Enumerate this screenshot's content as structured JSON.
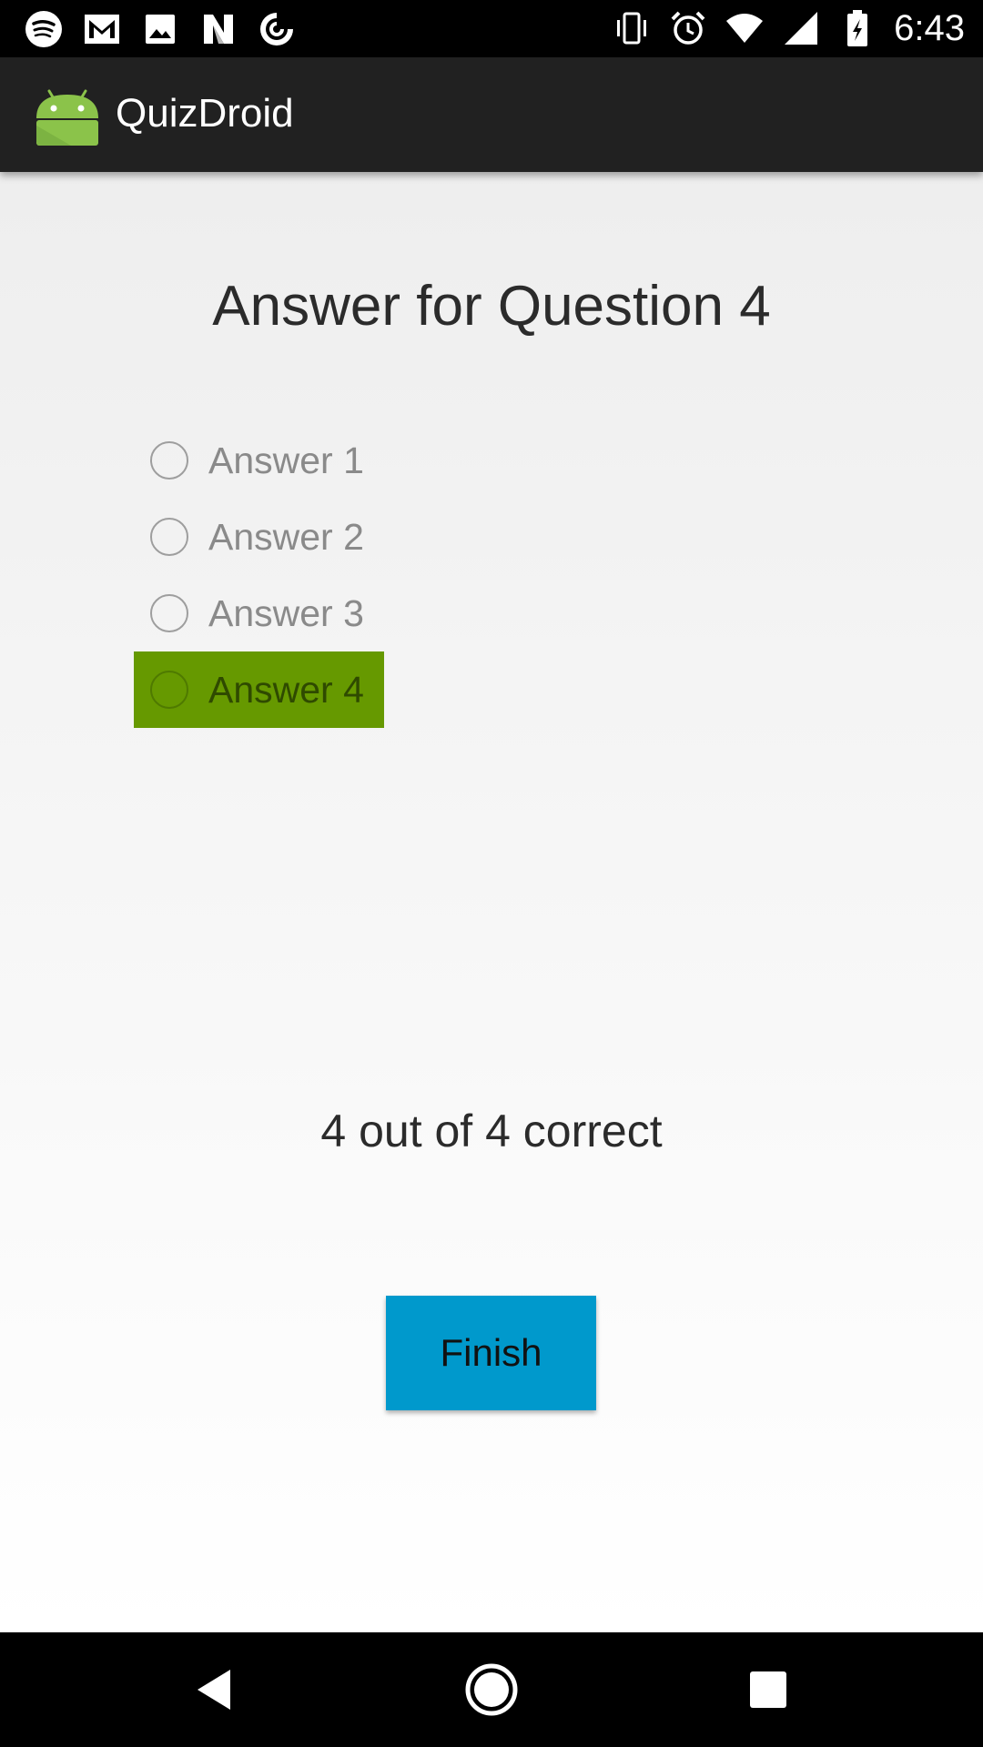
{
  "status_bar": {
    "time": "6:43",
    "left_icons": [
      "spotify-icon",
      "gmail-icon",
      "image-icon",
      "n-app-icon",
      "pocketcasts-icon"
    ],
    "right_icons": [
      "vibrate-icon",
      "alarm-icon",
      "wifi-icon",
      "cell-signal-icon",
      "battery-charging-icon"
    ]
  },
  "app_bar": {
    "title": "QuizDroid",
    "logo_icon": "android-icon",
    "logo_color": "#8bc34a"
  },
  "main": {
    "question_title": "Answer for Question 4",
    "answers": [
      {
        "label": "Answer 1",
        "selected": false
      },
      {
        "label": "Answer 2",
        "selected": false
      },
      {
        "label": "Answer 3",
        "selected": false
      },
      {
        "label": "Answer 4",
        "selected": true
      }
    ],
    "highlight_color": "#669900",
    "score_text": "4 out of 4 correct",
    "finish_label": "Finish",
    "finish_color": "#0099cc"
  },
  "nav_bar": {
    "icons": [
      "back-icon",
      "home-icon",
      "recents-icon"
    ]
  }
}
